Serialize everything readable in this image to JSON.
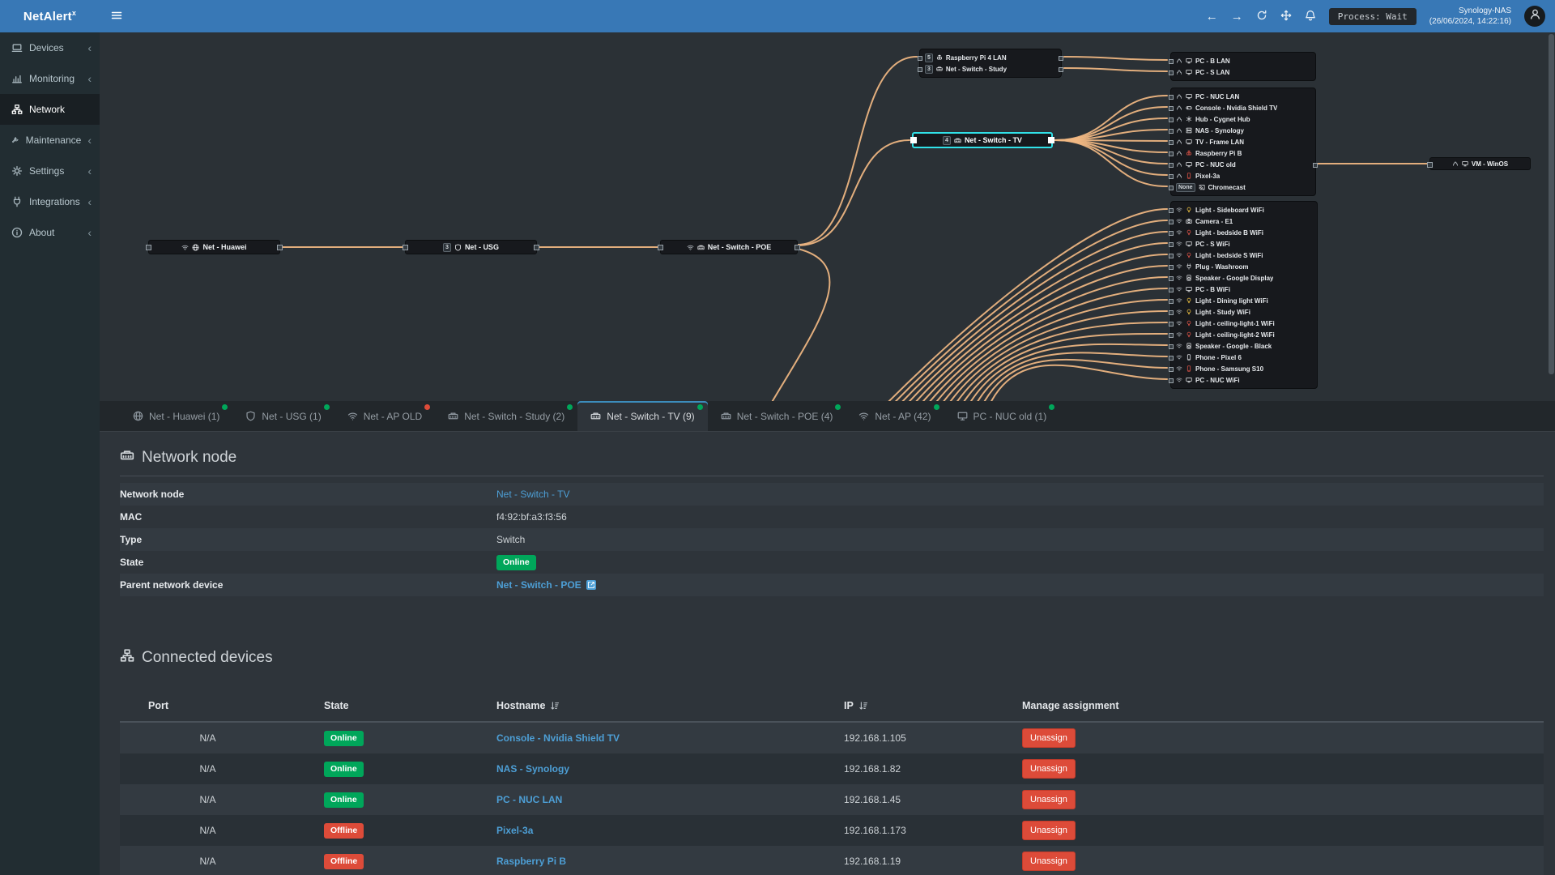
{
  "brand": {
    "name": "NetAlert",
    "sup": "x"
  },
  "topbar": {
    "process": "Process: Wait",
    "host": "Synology-NAS",
    "time": "(26/06/2024, 14:22:16)"
  },
  "colors": {
    "online": "#00a65a",
    "offline": "#dd4b39",
    "accent": "#3c8dbc",
    "link": "#4d9fd6",
    "edge": "#f2b983"
  },
  "sidebar": [
    {
      "label": "Devices",
      "icon": "laptop",
      "chevron": true
    },
    {
      "label": "Monitoring",
      "icon": "chart",
      "chevron": true
    },
    {
      "label": "Network",
      "icon": "sitemap",
      "active": true
    },
    {
      "label": "Maintenance",
      "icon": "wrench",
      "chevron": true
    },
    {
      "label": "Settings",
      "icon": "gear",
      "chevron": true
    },
    {
      "label": "Integrations",
      "icon": "plug",
      "chevron": true
    },
    {
      "label": "About",
      "icon": "info",
      "chevron": true
    }
  ],
  "diagram": {
    "chain": [
      {
        "label": "Net - Huawei",
        "icons": [
          {
            "n": "wifi",
            "c": "#aeb4ba"
          },
          {
            "n": "globe",
            "c": "#e8eaed"
          }
        ]
      },
      {
        "label": "Net - USG",
        "badge": "3",
        "icons": [
          {
            "n": "shield",
            "c": "#e8eaed"
          }
        ]
      },
      {
        "label": "Net - Switch - POE",
        "icons": [
          {
            "n": "wifi",
            "c": "#aeb4ba"
          },
          {
            "n": "switch",
            "c": "#e8eaed"
          }
        ]
      },
      {
        "label": "Net - Switch - TV",
        "badge": "4",
        "icons": [
          {
            "n": "switch",
            "c": "#e8eaed"
          }
        ],
        "selected": true
      }
    ],
    "groups": {
      "top": [
        {
          "badge": "5",
          "icons": [
            {
              "n": "raspberry",
              "c": "#e8eaed"
            }
          ],
          "label": "Raspberry Pi 4 LAN"
        },
        {
          "badge": "3",
          "icons": [
            {
              "n": "switch",
              "c": "#e8eaed"
            }
          ],
          "label": "Net - Switch - Study"
        }
      ],
      "lan": [
        {
          "icons": [
            {
              "n": "eth",
              "c": "#aeb4ba"
            },
            {
              "n": "monitor",
              "c": "#e8eaed"
            }
          ],
          "label": "PC - B LAN"
        },
        {
          "icons": [
            {
              "n": "eth",
              "c": "#aeb4ba"
            },
            {
              "n": "monitor",
              "c": "#e8eaed"
            }
          ],
          "label": "PC - S LAN"
        }
      ],
      "tv": [
        {
          "icons": [
            {
              "n": "eth",
              "c": "#aeb4ba"
            },
            {
              "n": "monitor",
              "c": "#e8eaed"
            }
          ],
          "label": "PC - NUC LAN"
        },
        {
          "icons": [
            {
              "n": "eth",
              "c": "#aeb4ba"
            },
            {
              "n": "gamepad",
              "c": "#e8eaed"
            }
          ],
          "label": "Console - Nvidia Shield TV"
        },
        {
          "icons": [
            {
              "n": "eth",
              "c": "#aeb4ba"
            },
            {
              "n": "hub",
              "c": "#e8eaed"
            }
          ],
          "label": "Hub - Cygnet Hub"
        },
        {
          "icons": [
            {
              "n": "eth",
              "c": "#aeb4ba"
            },
            {
              "n": "server",
              "c": "#e8eaed"
            }
          ],
          "label": "NAS - Synology"
        },
        {
          "icons": [
            {
              "n": "eth",
              "c": "#aeb4ba"
            },
            {
              "n": "tv",
              "c": "#e8eaed"
            }
          ],
          "label": "TV - Frame LAN"
        },
        {
          "icons": [
            {
              "n": "eth",
              "c": "#aeb4ba"
            },
            {
              "n": "raspberry",
              "c": "#e05347"
            }
          ],
          "label": "Raspberry Pi B"
        },
        {
          "icons": [
            {
              "n": "eth",
              "c": "#aeb4ba"
            },
            {
              "n": "monitor",
              "c": "#e8eaed"
            }
          ],
          "label": "PC - NUC old"
        },
        {
          "icons": [
            {
              "n": "eth",
              "c": "#aeb4ba"
            },
            {
              "n": "phone",
              "c": "#e05347"
            }
          ],
          "label": "Pixel-3a"
        },
        {
          "port": "None",
          "icons": [
            {
              "n": "cast",
              "c": "#e8eaed"
            }
          ],
          "label": "Chromecast"
        }
      ],
      "wifi": [
        {
          "icons": [
            {
              "n": "wifi",
              "c": "#aeb4ba"
            },
            {
              "n": "bulb",
              "c": "#f4c542"
            }
          ],
          "label": "Light - Sideboard WiFi"
        },
        {
          "icons": [
            {
              "n": "wifi",
              "c": "#aeb4ba"
            },
            {
              "n": "camera",
              "c": "#e8eaed"
            }
          ],
          "label": "Camera - E1"
        },
        {
          "icons": [
            {
              "n": "wifi",
              "c": "#aeb4ba"
            },
            {
              "n": "bulb",
              "c": "#e05347"
            }
          ],
          "label": "Light - bedside B WiFi"
        },
        {
          "icons": [
            {
              "n": "wifi",
              "c": "#aeb4ba"
            },
            {
              "n": "monitor",
              "c": "#e8eaed"
            }
          ],
          "label": "PC - S WiFi"
        },
        {
          "icons": [
            {
              "n": "wifi",
              "c": "#aeb4ba"
            },
            {
              "n": "bulb",
              "c": "#e05347"
            }
          ],
          "label": "Light - bedside S WiFi"
        },
        {
          "icons": [
            {
              "n": "wifi",
              "c": "#aeb4ba"
            },
            {
              "n": "plug",
              "c": "#e8eaed"
            }
          ],
          "label": "Plug - Washroom"
        },
        {
          "icons": [
            {
              "n": "wifi",
              "c": "#aeb4ba"
            },
            {
              "n": "speaker",
              "c": "#e8eaed"
            }
          ],
          "label": "Speaker - Google Display"
        },
        {
          "icons": [
            {
              "n": "wifi",
              "c": "#aeb4ba"
            },
            {
              "n": "monitor",
              "c": "#e8eaed"
            }
          ],
          "label": "PC - B WiFi"
        },
        {
          "icons": [
            {
              "n": "wifi",
              "c": "#aeb4ba"
            },
            {
              "n": "bulb",
              "c": "#f4c542"
            }
          ],
          "label": "Light - Dining light WiFi"
        },
        {
          "icons": [
            {
              "n": "wifi",
              "c": "#aeb4ba"
            },
            {
              "n": "bulb",
              "c": "#f4c542"
            }
          ],
          "label": "Light - Study WiFi"
        },
        {
          "icons": [
            {
              "n": "wifi",
              "c": "#aeb4ba"
            },
            {
              "n": "bulb",
              "c": "#e05347"
            }
          ],
          "label": "Light - ceiling-light-1 WiFi"
        },
        {
          "icons": [
            {
              "n": "wifi",
              "c": "#aeb4ba"
            },
            {
              "n": "bulb",
              "c": "#e05347"
            }
          ],
          "label": "Light - ceiling-light-2 WiFi"
        },
        {
          "icons": [
            {
              "n": "wifi",
              "c": "#aeb4ba"
            },
            {
              "n": "speaker",
              "c": "#e8eaed"
            }
          ],
          "label": "Speaker - Google - Black"
        },
        {
          "icons": [
            {
              "n": "wifi",
              "c": "#aeb4ba"
            },
            {
              "n": "phone",
              "c": "#e8eaed"
            }
          ],
          "label": "Phone - Pixel 6"
        },
        {
          "icons": [
            {
              "n": "wifi",
              "c": "#aeb4ba"
            },
            {
              "n": "phone",
              "c": "#e05347"
            }
          ],
          "label": "Phone - Samsung S10"
        },
        {
          "icons": [
            {
              "n": "wifi",
              "c": "#aeb4ba"
            },
            {
              "n": "monitor",
              "c": "#e8eaed"
            }
          ],
          "label": "PC - NUC WiFi"
        }
      ]
    },
    "vm": {
      "icons": [
        {
          "n": "eth",
          "c": "#aeb4ba"
        },
        {
          "n": "monitor",
          "c": "#e8eaed"
        }
      ],
      "label": "VM - WinOS"
    }
  },
  "tabs": [
    {
      "icon": "globe",
      "label": "Net - Huawei (1)",
      "dot": "#00a65a"
    },
    {
      "icon": "shield",
      "label": "Net - USG (1)",
      "dot": "#00a65a"
    },
    {
      "icon": "wifi",
      "label": "Net - AP OLD",
      "dot": "#dd4b39"
    },
    {
      "icon": "switch",
      "label": "Net - Switch - Study (2)",
      "dot": "#00a65a"
    },
    {
      "icon": "switch",
      "label": "Net - Switch - TV (9)",
      "dot": "#00a65a",
      "active": true
    },
    {
      "icon": "switch",
      "label": "Net - Switch - POE (4)",
      "dot": "#00a65a"
    },
    {
      "icon": "wifi",
      "label": "Net - AP (42)",
      "dot": "#00a65a"
    },
    {
      "icon": "monitor",
      "label": "PC - NUC old (1)",
      "dot": "#00a65a"
    }
  ],
  "node_section": {
    "title": "Network node",
    "rows": [
      {
        "label": "Network node",
        "value": "Net - Switch - TV",
        "type": "link"
      },
      {
        "label": "MAC",
        "value": "f4:92:bf:a3:f3:56"
      },
      {
        "label": "Type",
        "value": "Switch"
      },
      {
        "label": "State",
        "value": "Online",
        "type": "badge"
      },
      {
        "label": "Parent network device",
        "value": "Net - Switch - POE",
        "type": "link-ext"
      }
    ]
  },
  "devices_section": {
    "title": "Connected devices",
    "columns": [
      {
        "label": "Port"
      },
      {
        "label": "State"
      },
      {
        "label": "Hostname",
        "sortable": true
      },
      {
        "label": "IP",
        "sortable": true
      },
      {
        "label": "Manage assignment"
      }
    ],
    "unassign_label": "Unassign",
    "rows": [
      {
        "port": "N/A",
        "state": "Online",
        "hostname": "Console - Nvidia Shield TV",
        "ip": "192.168.1.105"
      },
      {
        "port": "N/A",
        "state": "Online",
        "hostname": "NAS - Synology",
        "ip": "192.168.1.82"
      },
      {
        "port": "N/A",
        "state": "Online",
        "hostname": "PC - NUC LAN",
        "ip": "192.168.1.45"
      },
      {
        "port": "N/A",
        "state": "Offline",
        "hostname": "Pixel-3a",
        "ip": "192.168.1.173"
      },
      {
        "port": "N/A",
        "state": "Offline",
        "hostname": "Raspberry Pi B",
        "ip": "192.168.1.19"
      }
    ]
  }
}
